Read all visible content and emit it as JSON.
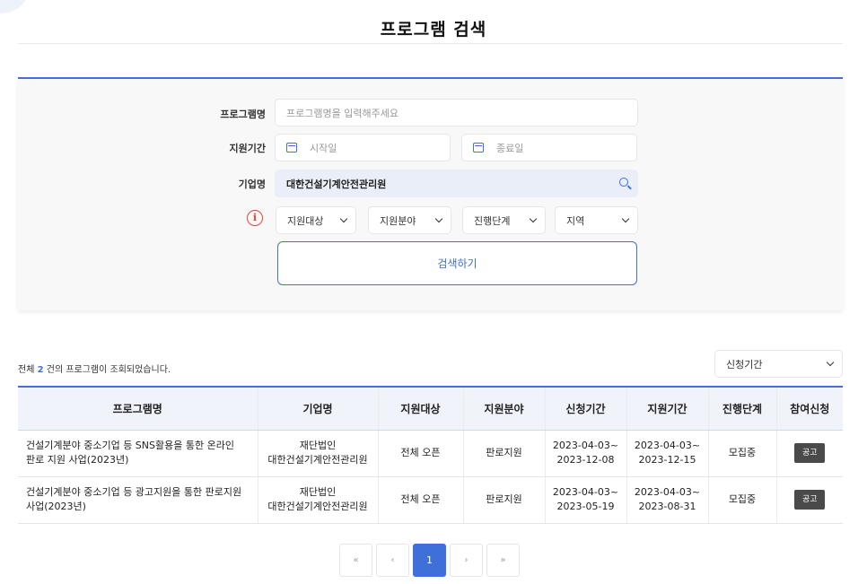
{
  "page": {
    "title": "프로그램 검색"
  },
  "search": {
    "program_label": "프로그램명",
    "program_placeholder": "프로그램명을 입력해주세요",
    "period_label": "지원기간",
    "start_placeholder": "시작일",
    "end_placeholder": "종료일",
    "company_label": "기업명",
    "company_value": "대한건설기계안전관리원",
    "filters": [
      "지원대상",
      "지원분야",
      "진행단계",
      "지역"
    ],
    "info_symbol": "i",
    "submit_label": "검색하기"
  },
  "results": {
    "prefix": "전체",
    "count": "2",
    "suffix": "건의 프로그램이 조회되었습니다.",
    "sort_value": "신청기간",
    "columns": [
      "프로그램명",
      "기업명",
      "지원대상",
      "지원분야",
      "신청기간",
      "지원기간",
      "진행단계",
      "참여신청"
    ],
    "rows": [
      {
        "program": "건설기계분야 중소기업 등 SNS활용을 통한 온라인 판로 지원 사업(2023년)",
        "company_line1": "재단법인",
        "company_line2": "대한건설기계안전관리원",
        "target": "전체 오픈",
        "field": "판로지원",
        "apply_start": "2023-04-03~",
        "apply_end": "2023-12-08",
        "support_start": "2023-04-03~",
        "support_end": "2023-12-15",
        "stage": "모집중",
        "action": "공고"
      },
      {
        "program": "건설기계분야 중소기업 등 광고지원을 통한 판로지원 사업(2023년)",
        "company_line1": "재단법인",
        "company_line2": "대한건설기계안전관리원",
        "target": "전체 오픈",
        "field": "판로지원",
        "apply_start": "2023-04-03~",
        "apply_end": "2023-05-19",
        "support_start": "2023-04-03~",
        "support_end": "2023-08-31",
        "stage": "모집중",
        "action": "공고"
      }
    ]
  },
  "pagination": {
    "first": "«",
    "prev": "‹",
    "current": "1",
    "next": "›",
    "last": "»"
  },
  "colors": {
    "accent": "#3f6fd8",
    "alert": "#e0453a",
    "notice_button": "#4a4a4a"
  }
}
